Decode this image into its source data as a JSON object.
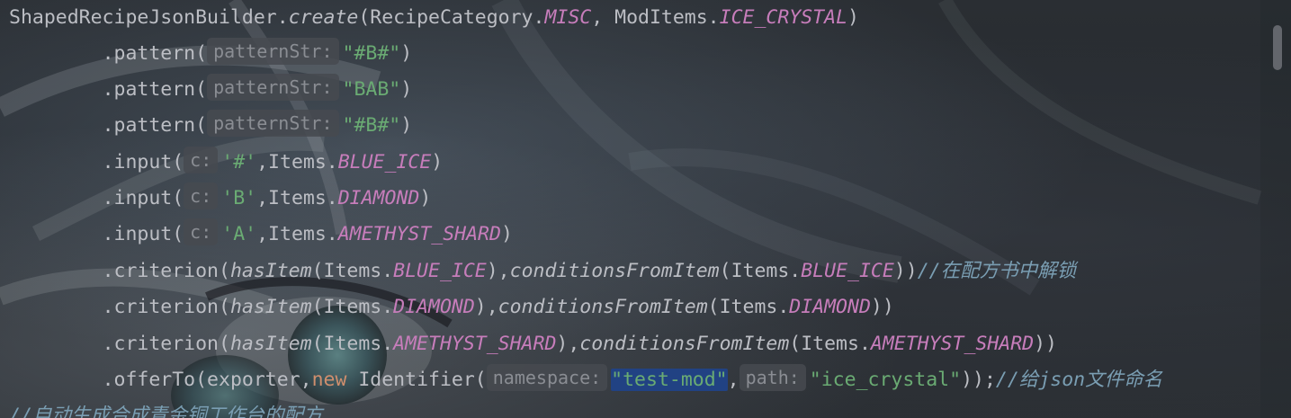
{
  "lines": [
    {
      "indent": "",
      "tokens": [
        {
          "t": "ShapedRecipeJsonBuilder.",
          "c": "plain"
        },
        {
          "t": "create",
          "c": "static"
        },
        {
          "t": "(RecipeCategory.",
          "c": "plain"
        },
        {
          "t": "MISC",
          "c": "const"
        },
        {
          "t": ", ModItems.",
          "c": "plain"
        },
        {
          "t": "ICE_CRYSTAL",
          "c": "const"
        },
        {
          "t": ")",
          "c": "plain"
        }
      ]
    },
    {
      "indent": "        ",
      "tokens": [
        {
          "t": ".pattern(",
          "c": "plain"
        },
        {
          "t": "patternStr:",
          "c": "hint"
        },
        {
          "t": "\"#B#\"",
          "c": "str"
        },
        {
          "t": ")",
          "c": "plain"
        }
      ]
    },
    {
      "indent": "        ",
      "tokens": [
        {
          "t": ".pattern(",
          "c": "plain"
        },
        {
          "t": "patternStr:",
          "c": "hint"
        },
        {
          "t": "\"BAB\"",
          "c": "str"
        },
        {
          "t": ")",
          "c": "plain"
        }
      ]
    },
    {
      "indent": "        ",
      "tokens": [
        {
          "t": ".pattern(",
          "c": "plain"
        },
        {
          "t": "patternStr:",
          "c": "hint"
        },
        {
          "t": "\"#B#\"",
          "c": "str"
        },
        {
          "t": ")",
          "c": "plain"
        }
      ]
    },
    {
      "indent": "        ",
      "tokens": [
        {
          "t": ".input(",
          "c": "plain"
        },
        {
          "t": "c:",
          "c": "hint"
        },
        {
          "t": "'#'",
          "c": "str"
        },
        {
          "t": ",Items.",
          "c": "plain"
        },
        {
          "t": "BLUE_ICE",
          "c": "const"
        },
        {
          "t": ")",
          "c": "plain"
        }
      ]
    },
    {
      "indent": "        ",
      "tokens": [
        {
          "t": ".input(",
          "c": "plain"
        },
        {
          "t": "c:",
          "c": "hint"
        },
        {
          "t": "'B'",
          "c": "str"
        },
        {
          "t": ",Items.",
          "c": "plain"
        },
        {
          "t": "DIAMOND",
          "c": "const"
        },
        {
          "t": ")",
          "c": "plain"
        }
      ]
    },
    {
      "indent": "        ",
      "tokens": [
        {
          "t": ".input(",
          "c": "plain"
        },
        {
          "t": "c:",
          "c": "hint"
        },
        {
          "t": "'A'",
          "c": "str"
        },
        {
          "t": ",Items.",
          "c": "plain"
        },
        {
          "t": "AMETHYST_SHARD",
          "c": "const"
        },
        {
          "t": ")",
          "c": "plain"
        }
      ]
    },
    {
      "indent": "        ",
      "tokens": [
        {
          "t": ".criterion(",
          "c": "plain"
        },
        {
          "t": "hasItem",
          "c": "static"
        },
        {
          "t": "(Items.",
          "c": "plain"
        },
        {
          "t": "BLUE_ICE",
          "c": "const"
        },
        {
          "t": "),",
          "c": "plain"
        },
        {
          "t": "conditionsFromItem",
          "c": "static"
        },
        {
          "t": "(Items.",
          "c": "plain"
        },
        {
          "t": "BLUE_ICE",
          "c": "const"
        },
        {
          "t": "))",
          "c": "plain"
        },
        {
          "t": "//在配方书中解锁",
          "c": "cmt"
        }
      ]
    },
    {
      "indent": "        ",
      "tokens": [
        {
          "t": ".criterion(",
          "c": "plain"
        },
        {
          "t": "hasItem",
          "c": "static"
        },
        {
          "t": "(Items.",
          "c": "plain"
        },
        {
          "t": "DIAMOND",
          "c": "const"
        },
        {
          "t": "),",
          "c": "plain"
        },
        {
          "t": "conditionsFromItem",
          "c": "static"
        },
        {
          "t": "(Items.",
          "c": "plain"
        },
        {
          "t": "DIAMOND",
          "c": "const"
        },
        {
          "t": "))",
          "c": "plain"
        }
      ]
    },
    {
      "indent": "        ",
      "tokens": [
        {
          "t": ".criterion(",
          "c": "plain"
        },
        {
          "t": "hasItem",
          "c": "static"
        },
        {
          "t": "(Items.",
          "c": "plain"
        },
        {
          "t": "AMETHYST_SHARD",
          "c": "const"
        },
        {
          "t": "),",
          "c": "plain"
        },
        {
          "t": "conditionsFromItem",
          "c": "static"
        },
        {
          "t": "(Items.",
          "c": "plain"
        },
        {
          "t": "AMETHYST_SHARD",
          "c": "const"
        },
        {
          "t": "))",
          "c": "plain"
        }
      ]
    },
    {
      "indent": "        ",
      "tokens": [
        {
          "t": ".offerTo(exporter,",
          "c": "plain"
        },
        {
          "t": "new",
          "c": "kw"
        },
        {
          "t": " Identifier(",
          "c": "plain"
        },
        {
          "t": "namespace:",
          "c": "hint"
        },
        {
          "t": "\"test-mod\"",
          "c": "str",
          "sel": true
        },
        {
          "t": ",",
          "c": "plain"
        },
        {
          "t": "path:",
          "c": "hint"
        },
        {
          "t": "\"ice_crystal\"",
          "c": "str"
        },
        {
          "t": "));",
          "c": "plain"
        },
        {
          "t": "//给json文件命名",
          "c": "cmt"
        }
      ]
    },
    {
      "indent": "",
      "tokens": [
        {
          "t": "//自动生成合成青金铜工作台的配方",
          "c": "cmt"
        }
      ]
    }
  ],
  "colors": {
    "plain": "#bcbec4",
    "const": "#c77dbb",
    "str": "#6aab73",
    "kw": "#cf8e6d",
    "cmt": "#7a9eb3",
    "selection": "#214283"
  }
}
